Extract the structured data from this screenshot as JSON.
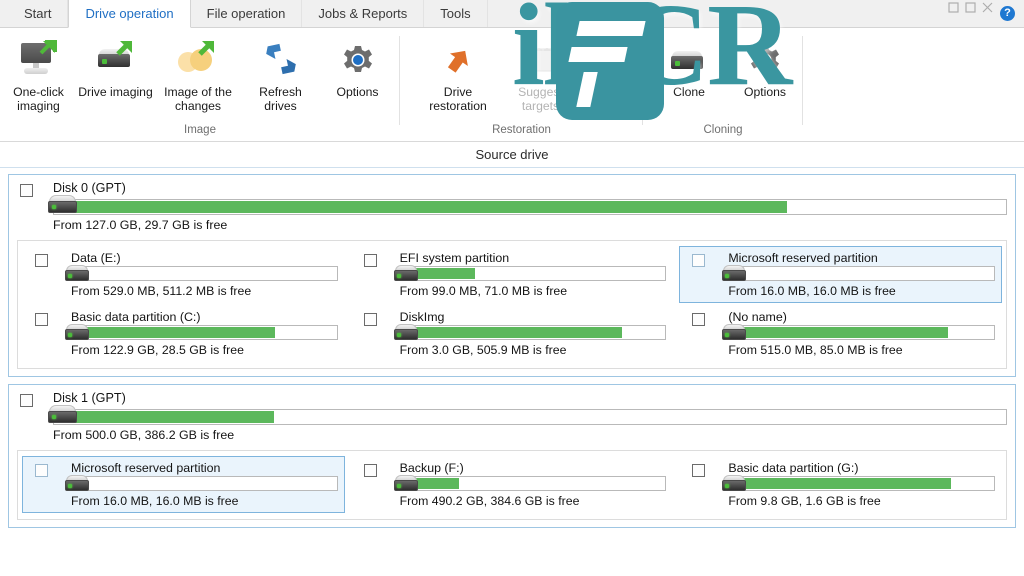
{
  "window": {
    "help_icon": "help-circle-icon",
    "help_label": "?"
  },
  "tabs": [
    {
      "label": "Start",
      "active": false
    },
    {
      "label": "Drive operation",
      "active": true
    },
    {
      "label": "File operation",
      "active": false
    },
    {
      "label": "Jobs & Reports",
      "active": false
    },
    {
      "label": "Tools",
      "active": false
    }
  ],
  "ribbon": {
    "groups": [
      {
        "name": "Image",
        "buttons": [
          {
            "label": "One-click imaging",
            "icon": "monitor-export-icon",
            "disabled": false
          },
          {
            "label": "Drive imaging",
            "icon": "drive-export-icon",
            "disabled": false
          },
          {
            "label": "Image of the changes",
            "icon": "incremental-image-icon",
            "disabled": false
          },
          {
            "label": "Refresh drives",
            "icon": "refresh-arrows-icon",
            "disabled": false
          },
          {
            "label": "Options",
            "icon": "gear-icon",
            "disabled": false
          }
        ]
      },
      {
        "name": "Restoration",
        "buttons": [
          {
            "label": "Drive restoration",
            "icon": "restore-arrow-icon",
            "disabled": false
          },
          {
            "label": "Suggest targets",
            "icon": "suggest-targets-icon",
            "disabled": true
          }
        ]
      },
      {
        "name": "Cloning",
        "buttons": [
          {
            "label": "Clone",
            "icon": "clone-drive-icon",
            "disabled": false
          },
          {
            "label": "Options",
            "icon": "gear-icon",
            "disabled": false
          }
        ]
      }
    ]
  },
  "watermark": {
    "text": "ileCR",
    "badge_letter": "F",
    "color": "#3a94a0"
  },
  "source": {
    "header": "Source drive",
    "disks": [
      {
        "title": "Disk 0 (GPT)",
        "summary": "From 127.0 GB, 29.7 GB is free",
        "used_percent": 77,
        "checked": false,
        "partitions": [
          {
            "title": "Data (E:)",
            "summary": "From 529.0 MB, 511.2 MB is free",
            "used_percent": 3,
            "checked": false,
            "selected": false
          },
          {
            "title": "EFI system partition",
            "summary": "From 99.0 MB, 71.0 MB is free",
            "used_percent": 28,
            "checked": false,
            "selected": false
          },
          {
            "title": "Microsoft reserved partition",
            "summary": "From 16.0 MB, 16.0 MB is free",
            "used_percent": 0,
            "checked": false,
            "selected": true
          },
          {
            "title": "Basic data partition (C:)",
            "summary": "From 122.9 GB, 28.5 GB is free",
            "used_percent": 77,
            "checked": false,
            "selected": false
          },
          {
            "title": "DiskImg",
            "summary": "From 3.0 GB, 505.9 MB is free",
            "used_percent": 84,
            "checked": false,
            "selected": false
          },
          {
            "title": "(No name)",
            "summary": "From 515.0 MB, 85.0 MB is free",
            "used_percent": 83,
            "checked": false,
            "selected": false
          }
        ]
      },
      {
        "title": "Disk 1 (GPT)",
        "summary": "From 500.0 GB, 386.2 GB is free",
        "used_percent": 23,
        "checked": false,
        "partitions": [
          {
            "title": "Microsoft reserved partition",
            "summary": "From 16.0 MB, 16.0 MB is free",
            "used_percent": 0,
            "checked": false,
            "selected": true
          },
          {
            "title": "Backup (F:)",
            "summary": "From 490.2 GB, 384.6 GB is free",
            "used_percent": 22,
            "checked": false,
            "selected": false
          },
          {
            "title": "Basic data partition (G:)",
            "summary": "From 9.8 GB, 1.6 GB is free",
            "used_percent": 84,
            "checked": false,
            "selected": false
          }
        ]
      }
    ]
  },
  "colors": {
    "accent_blue": "#1f6fc4",
    "bar_green": "#5cb85c",
    "selection_bg": "#eaf4fc",
    "selection_border": "#7eb4dd",
    "group_border": "#9fc6e3"
  }
}
